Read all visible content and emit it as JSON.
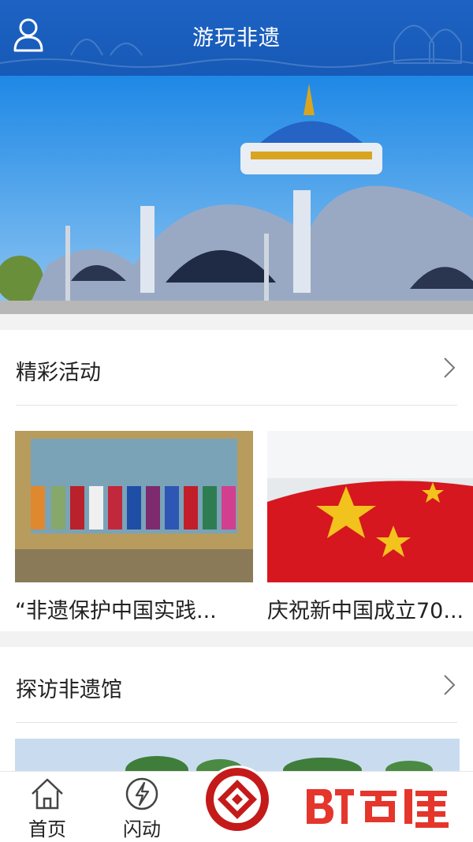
{
  "header": {
    "title": "游玩非遗",
    "icon": "user-icon"
  },
  "sections": [
    {
      "title": "精彩活动",
      "cards": [
        {
          "caption": "“非遗保护中国实践..."
        },
        {
          "caption": "庆祝新中国成立70..."
        }
      ]
    },
    {
      "title": "探访非遗馆"
    }
  ],
  "nav": [
    {
      "label": "首页",
      "icon": "home-icon"
    },
    {
      "label": "闪动",
      "icon": "lightning-icon"
    }
  ],
  "colors": {
    "header_blue": "#1a5fbf",
    "accent_red": "#c41a1a"
  }
}
